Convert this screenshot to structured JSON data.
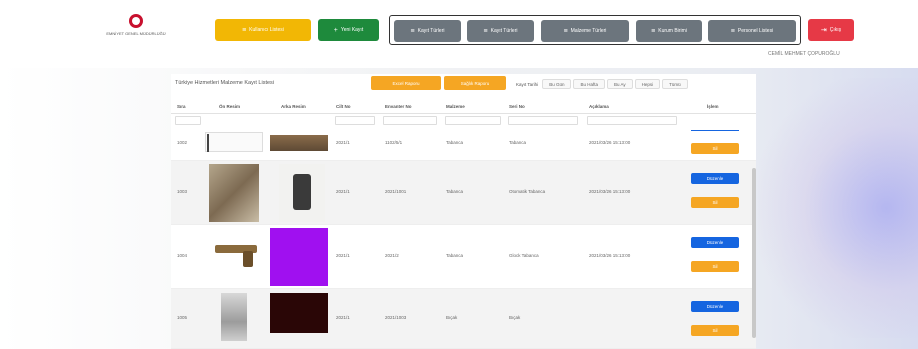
{
  "logo": {
    "line1": "EMNİYET GENEL MÜDÜRLÜĞÜ",
    "line2": "",
    "icon": "police-emblem-icon"
  },
  "header": {
    "primary_buttons": [
      {
        "label": "Kullanıcı Listesi",
        "icon": "list-icon"
      },
      {
        "label": "Yeni Kayıt",
        "icon": "plus-icon"
      }
    ],
    "gray_buttons": [
      {
        "label": "Kayıt Türleri",
        "icon": "list-icon"
      },
      {
        "label": "Kayıt Türleri",
        "icon": "list-icon"
      },
      {
        "label": "Malzeme Türleri",
        "icon": "list-icon"
      },
      {
        "label": "Kurum Birimi",
        "icon": "list-icon"
      },
      {
        "label": "Personel Listesi",
        "icon": "list-icon"
      }
    ],
    "logout": {
      "label": "Çıkış",
      "icon": "logout-icon"
    },
    "user_name": "CEMİL MEHMET ÇOPUROĞLU"
  },
  "panel": {
    "title": "Türkiye Hizmetleri Malzeme Kayıt Listesi",
    "top_buttons": [
      "Excel Raporu",
      "Sağlık Raporu"
    ],
    "filter_label": "Kayıt Tarihi",
    "filter_tabs": [
      "Bu Gün",
      "Bu Hafta",
      "Bu Ay",
      "Hepsi",
      "Tümü"
    ]
  },
  "table": {
    "columns": [
      "Sıra",
      "Ön Resim",
      "Arka Resim",
      "Cilt No",
      "Envanter No",
      "Malzeme",
      "Seri No",
      "Açıklama",
      "İşlem"
    ],
    "rows": [
      {
        "sira": "1002",
        "cilt": "2021/1",
        "envanter": "1102/5/1",
        "malzeme": "Tabanca",
        "tur": "Tabanca",
        "aciklama": "2021/03/26 15:13:00",
        "actions": [
          "Sil"
        ]
      },
      {
        "sira": "1003",
        "cilt": "2021/1",
        "envanter": "2021/1001",
        "malzeme": "Tabanca",
        "tur": "Otomatik Tabanca",
        "aciklama": "2021/03/26 15:13:00",
        "actions": [
          "Düzenle",
          "Sil"
        ]
      },
      {
        "sira": "1004",
        "cilt": "2021/1",
        "envanter": "2021/2",
        "malzeme": "Tabanca",
        "tur": "Glock Tabanca",
        "aciklama": "2021/03/26 15:13:00",
        "actions": [
          "Düzenle",
          "Sil"
        ]
      },
      {
        "sira": "1005",
        "cilt": "2021/1",
        "envanter": "2021/1003",
        "malzeme": "Bıçak",
        "tur": "Bıçak",
        "aciklama": "",
        "actions": [
          "Düzenle",
          "Sil"
        ]
      }
    ]
  },
  "colors": {
    "yellow": "#f2b705",
    "green": "#1e8a3c",
    "gray": "#6c757d",
    "red": "#e63946",
    "blue": "#1565e0",
    "orange": "#f5a623"
  }
}
